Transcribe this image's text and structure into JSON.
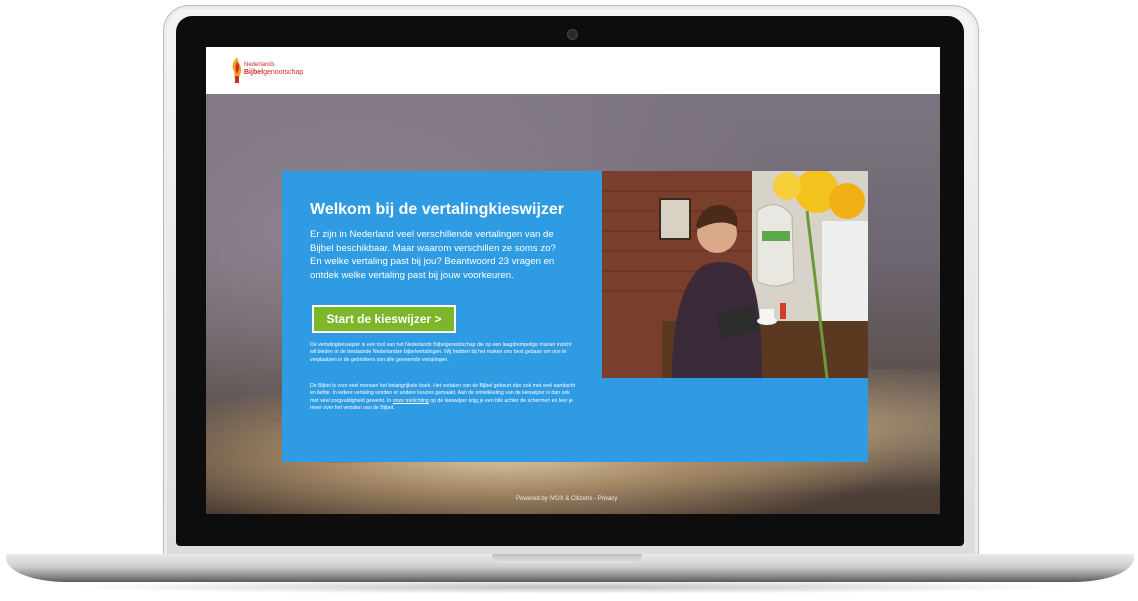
{
  "header": {
    "logo_line1": "Nederlands",
    "logo_line2_bold": "Bijbel",
    "logo_line2_rest": "genootschap"
  },
  "card": {
    "title": "Welkom bij de vertalingkieswijzer",
    "intro": "Er zijn in Nederland veel verschillende vertalingen van de Bijbel beschikbaar. Maar waarom verschillen ze soms zo? En welke vertaling past bij jou? Beantwoord 23 vragen en ontdek welke vertaling past bij jouw voorkeuren.",
    "start_button": "Start de kieswijzer >",
    "para1": "De vertalingkieswijzer is een tool van het Nederlands Bijbelgenootschap die op een laagdrempelige manier inzicht wil bieden in de bestaande Nederlandse bijbelvertalingen. Wij hebben bij het maken ons best gedaan om ons te verplaatsen in de gebruikers van alle genoemde vertalingen.",
    "para2_start": "De Bijbel is voor veel mensen het belangrijkste boek. Het vertalen van de Bijbel gebeurt dan ook met veel aandacht en liefde. In iedere vertaling worden er andere keuzes gemaakt. Aan de ontwikkeling van de kieswijzer is dan ook met veel zorgvuldigheid gewerkt. In ",
    "para2_link": "onze toelichting",
    "para2_end": " op de kieswijzer krijg je een blik achter de schermen en leer je meer over het vertalen van de Bijbel."
  },
  "footer": {
    "text": "Powered by IVOX & Citizens - Privacy"
  },
  "colors": {
    "card_blue": "#2e9be3",
    "button_green": "#7db729",
    "logo_red": "#d12b2b"
  }
}
